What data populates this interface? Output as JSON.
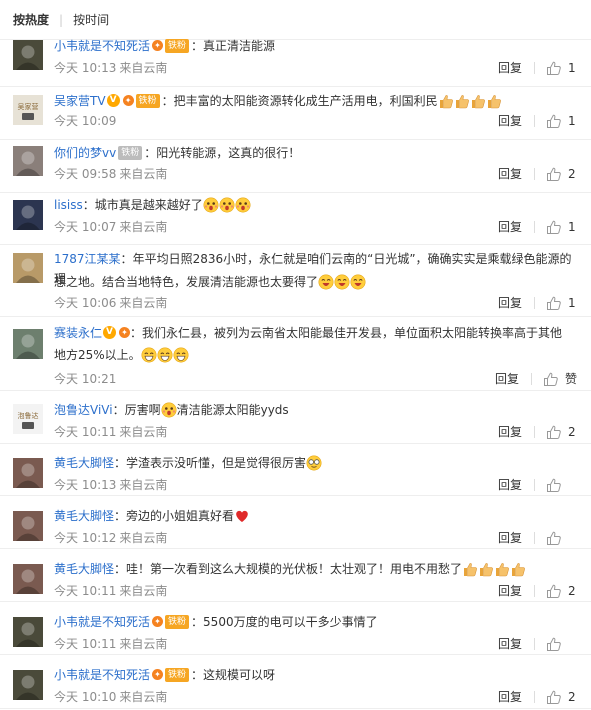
{
  "sort": {
    "hot": "按热度",
    "separator": "|",
    "time": "按时间"
  },
  "ui": {
    "reply_label": "回复",
    "like_label": "赞"
  },
  "comments": [
    {
      "user": "小韦就是不知死活",
      "badge": "铁粉",
      "badge_type": "iron",
      "vip": true,
      "verified": false,
      "text": "真正清洁能源",
      "time": "今天 10:13",
      "source": "来自云南",
      "likes": "1",
      "avatar_color": "#4a4a3a"
    },
    {
      "user": "吴家营TV",
      "badge": "铁粉",
      "badge_type": "iron",
      "vip": true,
      "verified": true,
      "text": "把丰富的太阳能资源转化成生产活用电，利国利民",
      "emojis": [
        "thumbs-up",
        "thumbs-up",
        "thumbs-up",
        "thumbs-up"
      ],
      "time": "今天 10:09",
      "source": "",
      "likes": "1",
      "avatar_color": "#e7e2d6",
      "avatar_text": "吴家营"
    },
    {
      "user": "你们的梦vv",
      "badge": "铁粉",
      "badge_type": "fan",
      "vip": false,
      "verified": false,
      "text": "阳光转能源，这真的很行！",
      "time": "今天 09:58",
      "source": "来自云南",
      "likes": "2",
      "avatar_color": "#8a7f7a"
    },
    {
      "user": "lisiss",
      "badge": "",
      "badge_type": "",
      "vip": false,
      "verified": false,
      "text": "城市真是越来越好了",
      "emojis": [
        "surprised",
        "surprised",
        "surprised"
      ],
      "time": "今天 10:07",
      "source": "来自云南",
      "likes": "1",
      "avatar_color": "#2c3550"
    },
    {
      "user": "1787江某某",
      "badge": "",
      "badge_type": "",
      "vip": false,
      "verified": false,
      "text_line1": "年平均日照2836小时，永仁就是咱们云南的“日光城”，确确实实是乘载绿色能源的理",
      "text_line2": "想之地。结合当地特色，发展清洁能源也太要得了",
      "emojis": [
        "cheer",
        "cheer",
        "cheer"
      ],
      "time": "今天 10:06",
      "source": "来自云南",
      "likes": "1",
      "avatar_color": "#b89a68"
    },
    {
      "user": "赛装永仁",
      "badge": "",
      "badge_type": "",
      "vip": true,
      "verified": true,
      "text_line1": "我们永仁县，被列为云南省太阳能最佳开发县，单位面积太阳能转换率高于其他",
      "text_line2": "地方25%以上。",
      "emojis": [
        "grin",
        "grin",
        "grin"
      ],
      "time": "今天 10:21",
      "source": "",
      "likes": "赞",
      "avatar_color": "#6d7f6e"
    },
    {
      "user": "泡鲁达ViVi",
      "badge": "",
      "badge_type": "",
      "vip": false,
      "verified": false,
      "text_a": "厉害啊",
      "emoji_mid": "surprised",
      "text_b": "清洁能源太阳能yyds",
      "time": "今天 10:11",
      "source": "来自云南",
      "likes": "2",
      "avatar_color": "#f3f3f3",
      "avatar_text": "泡鲁达"
    },
    {
      "user": "黄毛大脚怪",
      "badge": "",
      "badge_type": "",
      "vip": false,
      "verified": false,
      "text": "学渣表示没听懂，但是觉得很厉害",
      "emojis": [
        "cool"
      ],
      "time": "今天 10:13",
      "source": "来自云南",
      "likes": "",
      "avatar_color": "#7a5a50"
    },
    {
      "user": "黄毛大脚怪",
      "badge": "",
      "badge_type": "",
      "vip": false,
      "verified": false,
      "text": "旁边的小姐姐真好看",
      "emojis": [
        "heart"
      ],
      "time": "今天 10:12",
      "source": "来自云南",
      "likes": "",
      "avatar_color": "#7a5a50"
    },
    {
      "user": "黄毛大脚怪",
      "badge": "",
      "badge_type": "",
      "vip": false,
      "verified": false,
      "text": "哇！第一次看到这么大规模的光伏板！太壮观了！用电不用愁了",
      "emojis": [
        "thumbs-up",
        "thumbs-up",
        "thumbs-up",
        "thumbs-up"
      ],
      "time": "今天 10:11",
      "source": "来自云南",
      "likes": "2",
      "avatar_color": "#7a5a50"
    },
    {
      "user": "小韦就是不知死活",
      "badge": "铁粉",
      "badge_type": "iron",
      "vip": true,
      "verified": false,
      "text": "5500万度的电可以干多少事情了",
      "time": "今天 10:11",
      "source": "来自云南",
      "likes": "",
      "avatar_color": "#4a4a3a"
    },
    {
      "user": "小韦就是不知死活",
      "badge": "铁粉",
      "badge_type": "iron",
      "vip": true,
      "verified": false,
      "text": "这规模可以呀",
      "time": "今天 10:10",
      "source": "来自云南",
      "likes": "2",
      "avatar_color": "#4a4a3a"
    }
  ]
}
